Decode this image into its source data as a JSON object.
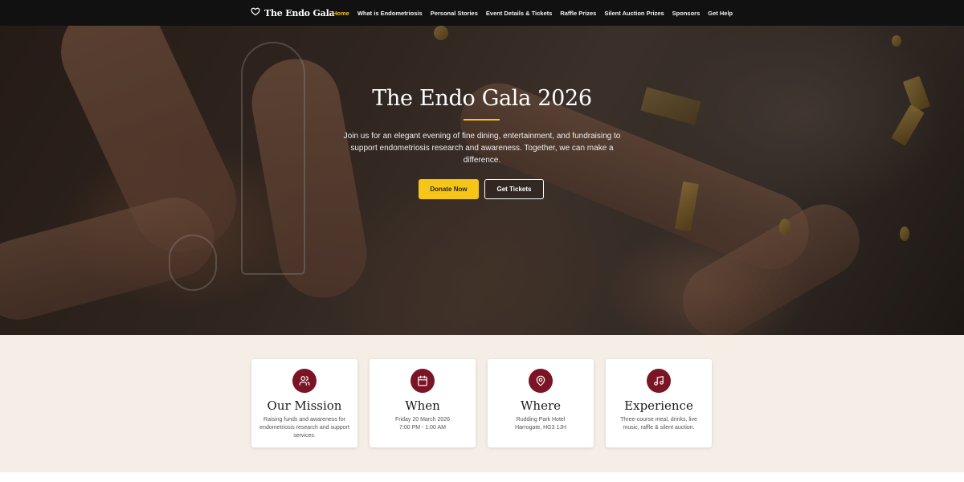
{
  "nav": {
    "brand": "The Endo Gala",
    "links": [
      {
        "label": "Home",
        "active": true
      },
      {
        "label": "What is Endometriosis",
        "active": false
      },
      {
        "label": "Personal Stories",
        "active": false
      },
      {
        "label": "Event Details & Tickets",
        "active": false
      },
      {
        "label": "Raffle Prizes",
        "active": false
      },
      {
        "label": "Silent Auction Prizes",
        "active": false
      },
      {
        "label": "Sponsors",
        "active": false
      },
      {
        "label": "Get Help",
        "active": false
      }
    ]
  },
  "hero": {
    "title": "The Endo Gala 2026",
    "subtitle": "Join us for an elegant evening of fine dining, entertainment, and fundraising to support endometriosis research and awareness. Together, we can make a difference.",
    "donate_label": "Donate Now",
    "tickets_label": "Get Tickets"
  },
  "cards": [
    {
      "icon": "users-icon",
      "title": "Our Mission",
      "text": "Raising funds and awareness for endometriosis research and support services."
    },
    {
      "icon": "calendar-icon",
      "title": "When",
      "text": "Friday 20 March 2026\n7:00 PM - 1:00 AM"
    },
    {
      "icon": "map-pin-icon",
      "title": "Where",
      "text": "Rudding Park Hotel\nHarrogate, HG3 1JH"
    },
    {
      "icon": "music-icon",
      "title": "Experience",
      "text": "Three-course meal, drinks, live music, raffle & silent auction."
    }
  ],
  "colors": {
    "accent": "#f5c518",
    "burgundy": "#7b1425",
    "nav_bg": "#111112",
    "section_bg": "#f5eee6"
  }
}
